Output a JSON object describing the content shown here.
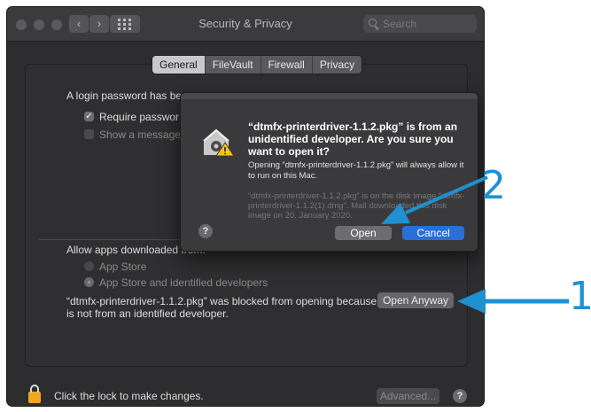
{
  "window": {
    "title": "Security & Privacy",
    "search_placeholder": "Search"
  },
  "tabs": [
    {
      "label": "General",
      "active": true
    },
    {
      "label": "FileVault",
      "active": false
    },
    {
      "label": "Firewall",
      "active": false
    },
    {
      "label": "Privacy",
      "active": false
    }
  ],
  "general": {
    "login_password_text": "A login password has be",
    "require_password_label": "Require passwor",
    "show_message_label": "Show a message",
    "allow_apps_label": "Allow apps downloaded from:",
    "option_app_store": "App Store",
    "option_identified": "App Store and identified developers",
    "blocked_line1": "“dtmfx-printerdriver-1.1.2.pkg” was blocked from opening because it",
    "blocked_line2": "is not from an identified developer.",
    "open_anyway_label": "Open Anyway"
  },
  "footer": {
    "lock_text": "Click the lock to make changes.",
    "advanced_label": "Advanced...",
    "help_label": "?"
  },
  "dialog": {
    "title": "“dtmfx-printerdriver-1.1.2.pkg” is from an unidentified developer. Are you sure you want to open it?",
    "message": "Opening “dtmfx-printerdriver-1.1.2.pkg” will always allow it to run on this Mac.",
    "info": "“dtmfx-printerdriver-1.1.2.pkg” is on the disk image “dtmfx-printerdriver-1.1.2(1).dmg”. Mail downloaded this disk image on 20. January 2020.",
    "open_label": "Open",
    "cancel_label": "Cancel",
    "help_label": "?"
  },
  "annotations": {
    "step1": "1",
    "step2": "2",
    "color": "#1f90d0"
  }
}
